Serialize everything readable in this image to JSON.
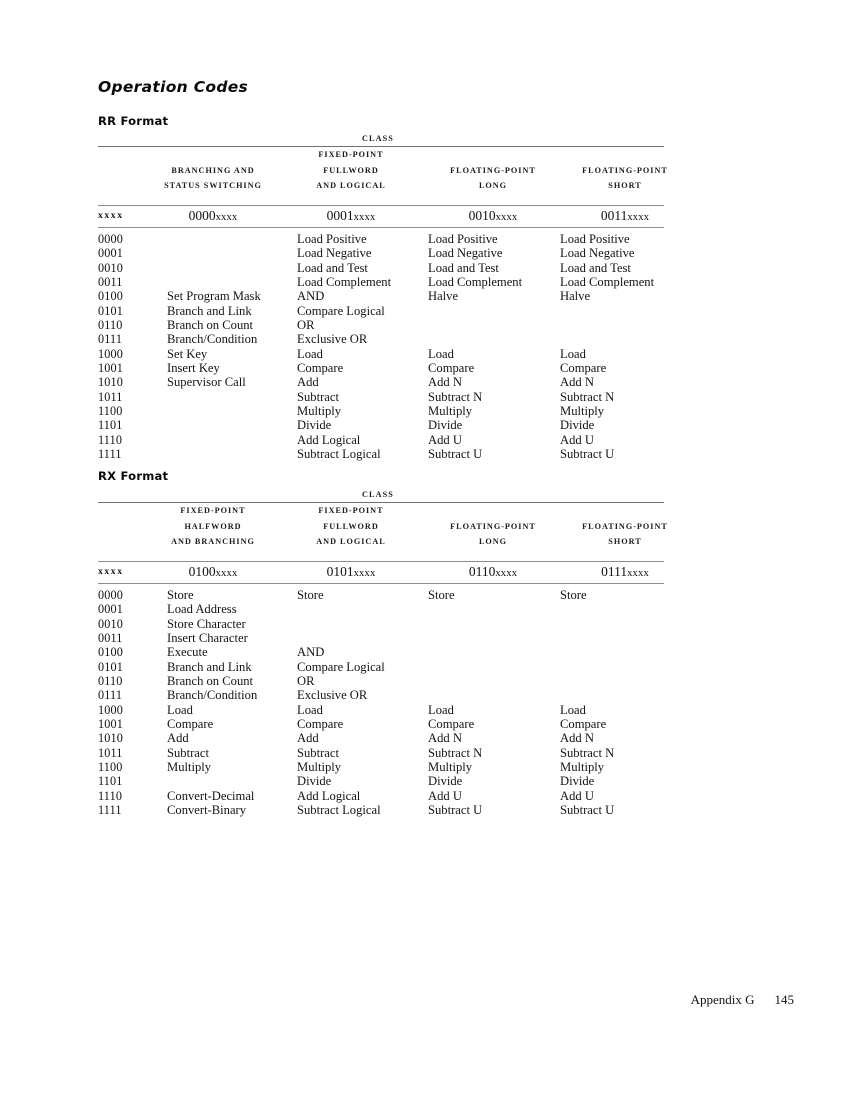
{
  "document": {
    "title": "Operation Codes",
    "footer_label": "Appendix G",
    "footer_page": "145"
  },
  "sections": [
    {
      "id": "rr",
      "heading": "RR Format",
      "class_label": "CLASS",
      "row_header": "xxxx",
      "columns": [
        {
          "header_lines": [
            "BRANCHING AND",
            "STATUS SWITCHING"
          ],
          "pattern_prefix": "0000",
          "pattern_suffix": "xxxx"
        },
        {
          "header_lines": [
            "FIXED-POINT",
            "FULLWORD",
            "AND LOGICAL"
          ],
          "pattern_prefix": "0001",
          "pattern_suffix": "xxxx"
        },
        {
          "header_lines": [
            "FLOATING-POINT",
            "LONG"
          ],
          "pattern_prefix": "0010",
          "pattern_suffix": "xxxx"
        },
        {
          "header_lines": [
            "FLOATING-POINT",
            "SHORT"
          ],
          "pattern_prefix": "0011",
          "pattern_suffix": "xxxx"
        }
      ],
      "rows": [
        {
          "code": "0000",
          "cells": [
            "",
            "Load Positive",
            "Load Positive",
            "Load Positive"
          ]
        },
        {
          "code": "0001",
          "cells": [
            "",
            "Load Negative",
            "Load Negative",
            "Load Negative"
          ]
        },
        {
          "code": "0010",
          "cells": [
            "",
            "Load and Test",
            "Load and Test",
            "Load and Test"
          ]
        },
        {
          "code": "0011",
          "cells": [
            "",
            "Load Complement",
            "Load Complement",
            "Load Complement"
          ]
        },
        {
          "code": "0100",
          "cells": [
            "Set Program Mask",
            "AND",
            "Halve",
            "Halve"
          ]
        },
        {
          "code": "0101",
          "cells": [
            "Branch and Link",
            "Compare Logical",
            "",
            ""
          ]
        },
        {
          "code": "0110",
          "cells": [
            "Branch on Count",
            "OR",
            "",
            ""
          ]
        },
        {
          "code": "0111",
          "cells": [
            "Branch/Condition",
            "Exclusive OR",
            "",
            ""
          ]
        },
        {
          "code": "1000",
          "cells": [
            "Set Key",
            "Load",
            "Load",
            "Load"
          ]
        },
        {
          "code": "1001",
          "cells": [
            "Insert Key",
            "Compare",
            "Compare",
            "Compare"
          ]
        },
        {
          "code": "1010",
          "cells": [
            "Supervisor Call",
            "Add",
            "Add N",
            "Add N"
          ]
        },
        {
          "code": "1011",
          "cells": [
            "",
            "Subtract",
            "Subtract N",
            "Subtract N"
          ]
        },
        {
          "code": "1100",
          "cells": [
            "",
            "Multiply",
            "Multiply",
            "Multiply"
          ]
        },
        {
          "code": "1101",
          "cells": [
            "",
            "Divide",
            "Divide",
            "Divide"
          ]
        },
        {
          "code": "1110",
          "cells": [
            "",
            "Add Logical",
            "Add U",
            "Add U"
          ]
        },
        {
          "code": "1111",
          "cells": [
            "",
            "Subtract Logical",
            "Subtract U",
            "Subtract U"
          ]
        }
      ]
    },
    {
      "id": "rx",
      "heading": "RX Format",
      "class_label": "CLASS",
      "row_header": "xxxx",
      "columns": [
        {
          "header_lines": [
            "FIXED-POINT",
            "HALFWORD",
            "AND BRANCHING"
          ],
          "pattern_prefix": "0100",
          "pattern_suffix": "xxxx"
        },
        {
          "header_lines": [
            "FIXED-POINT",
            "FULLWORD",
            "AND  LOGICAL"
          ],
          "pattern_prefix": "0101",
          "pattern_suffix": "xxxx"
        },
        {
          "header_lines": [
            "FLOATING-POINT",
            "LONG"
          ],
          "pattern_prefix": "0110",
          "pattern_suffix": "xxxx"
        },
        {
          "header_lines": [
            "FLOATING-POINT",
            "SHORT"
          ],
          "pattern_prefix": "0111",
          "pattern_suffix": "xxxx"
        }
      ],
      "rows": [
        {
          "code": "0000",
          "cells": [
            "Store",
            "Store",
            "Store",
            "Store"
          ]
        },
        {
          "code": "0001",
          "cells": [
            "Load Address",
            "",
            "",
            ""
          ]
        },
        {
          "code": "0010",
          "cells": [
            "Store Character",
            "",
            "",
            ""
          ]
        },
        {
          "code": "0011",
          "cells": [
            "Insert Character",
            "",
            "",
            ""
          ]
        },
        {
          "code": "0100",
          "cells": [
            "Execute",
            "AND",
            "",
            ""
          ]
        },
        {
          "code": "0101",
          "cells": [
            "Branch and Link",
            "Compare Logical",
            "",
            ""
          ]
        },
        {
          "code": "0110",
          "cells": [
            "Branch on Count",
            "OR",
            "",
            ""
          ]
        },
        {
          "code": "0111",
          "cells": [
            "Branch/Condition",
            "Exclusive OR",
            "",
            ""
          ]
        },
        {
          "code": "1000",
          "cells": [
            "Load",
            "Load",
            "Load",
            "Load"
          ]
        },
        {
          "code": "1001",
          "cells": [
            "Compare",
            "Compare",
            "Compare",
            "Compare"
          ]
        },
        {
          "code": "1010",
          "cells": [
            "Add",
            "Add",
            "Add N",
            "Add N"
          ]
        },
        {
          "code": "1011",
          "cells": [
            "Subtract",
            "Subtract",
            "Subtract N",
            "Subtract N"
          ]
        },
        {
          "code": "1100",
          "cells": [
            "Multiply",
            "Multiply",
            "Multiply",
            "Multiply"
          ]
        },
        {
          "code": "1101",
          "cells": [
            "",
            "Divide",
            "Divide",
            "Divide"
          ]
        },
        {
          "code": "1110",
          "cells": [
            "Convert-Decimal",
            "Add Logical",
            "Add U",
            "Add U"
          ]
        },
        {
          "code": "1111",
          "cells": [
            "Convert-Binary",
            "Subtract Logical",
            "Subtract U",
            "Subtract U"
          ]
        }
      ]
    }
  ]
}
